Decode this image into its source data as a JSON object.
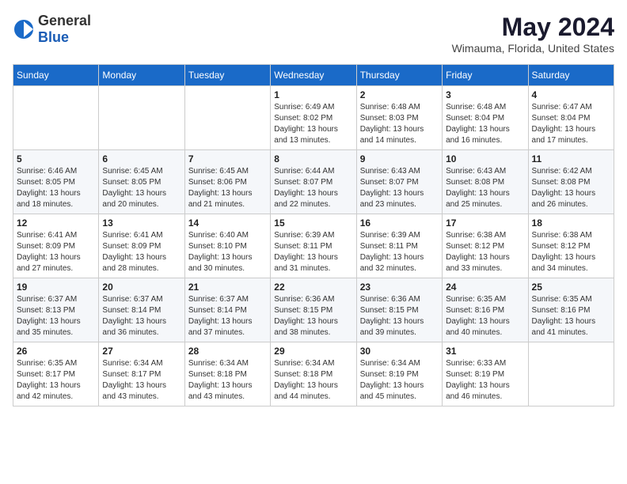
{
  "logo": {
    "general": "General",
    "blue": "Blue"
  },
  "header": {
    "month_year": "May 2024",
    "location": "Wimauma, Florida, United States"
  },
  "weekdays": [
    "Sunday",
    "Monday",
    "Tuesday",
    "Wednesday",
    "Thursday",
    "Friday",
    "Saturday"
  ],
  "weeks": [
    [
      {
        "day": "",
        "info": ""
      },
      {
        "day": "",
        "info": ""
      },
      {
        "day": "",
        "info": ""
      },
      {
        "day": "1",
        "info": "Sunrise: 6:49 AM\nSunset: 8:02 PM\nDaylight: 13 hours\nand 13 minutes."
      },
      {
        "day": "2",
        "info": "Sunrise: 6:48 AM\nSunset: 8:03 PM\nDaylight: 13 hours\nand 14 minutes."
      },
      {
        "day": "3",
        "info": "Sunrise: 6:48 AM\nSunset: 8:04 PM\nDaylight: 13 hours\nand 16 minutes."
      },
      {
        "day": "4",
        "info": "Sunrise: 6:47 AM\nSunset: 8:04 PM\nDaylight: 13 hours\nand 17 minutes."
      }
    ],
    [
      {
        "day": "5",
        "info": "Sunrise: 6:46 AM\nSunset: 8:05 PM\nDaylight: 13 hours\nand 18 minutes."
      },
      {
        "day": "6",
        "info": "Sunrise: 6:45 AM\nSunset: 8:05 PM\nDaylight: 13 hours\nand 20 minutes."
      },
      {
        "day": "7",
        "info": "Sunrise: 6:45 AM\nSunset: 8:06 PM\nDaylight: 13 hours\nand 21 minutes."
      },
      {
        "day": "8",
        "info": "Sunrise: 6:44 AM\nSunset: 8:07 PM\nDaylight: 13 hours\nand 22 minutes."
      },
      {
        "day": "9",
        "info": "Sunrise: 6:43 AM\nSunset: 8:07 PM\nDaylight: 13 hours\nand 23 minutes."
      },
      {
        "day": "10",
        "info": "Sunrise: 6:43 AM\nSunset: 8:08 PM\nDaylight: 13 hours\nand 25 minutes."
      },
      {
        "day": "11",
        "info": "Sunrise: 6:42 AM\nSunset: 8:08 PM\nDaylight: 13 hours\nand 26 minutes."
      }
    ],
    [
      {
        "day": "12",
        "info": "Sunrise: 6:41 AM\nSunset: 8:09 PM\nDaylight: 13 hours\nand 27 minutes."
      },
      {
        "day": "13",
        "info": "Sunrise: 6:41 AM\nSunset: 8:09 PM\nDaylight: 13 hours\nand 28 minutes."
      },
      {
        "day": "14",
        "info": "Sunrise: 6:40 AM\nSunset: 8:10 PM\nDaylight: 13 hours\nand 30 minutes."
      },
      {
        "day": "15",
        "info": "Sunrise: 6:39 AM\nSunset: 8:11 PM\nDaylight: 13 hours\nand 31 minutes."
      },
      {
        "day": "16",
        "info": "Sunrise: 6:39 AM\nSunset: 8:11 PM\nDaylight: 13 hours\nand 32 minutes."
      },
      {
        "day": "17",
        "info": "Sunrise: 6:38 AM\nSunset: 8:12 PM\nDaylight: 13 hours\nand 33 minutes."
      },
      {
        "day": "18",
        "info": "Sunrise: 6:38 AM\nSunset: 8:12 PM\nDaylight: 13 hours\nand 34 minutes."
      }
    ],
    [
      {
        "day": "19",
        "info": "Sunrise: 6:37 AM\nSunset: 8:13 PM\nDaylight: 13 hours\nand 35 minutes."
      },
      {
        "day": "20",
        "info": "Sunrise: 6:37 AM\nSunset: 8:14 PM\nDaylight: 13 hours\nand 36 minutes."
      },
      {
        "day": "21",
        "info": "Sunrise: 6:37 AM\nSunset: 8:14 PM\nDaylight: 13 hours\nand 37 minutes."
      },
      {
        "day": "22",
        "info": "Sunrise: 6:36 AM\nSunset: 8:15 PM\nDaylight: 13 hours\nand 38 minutes."
      },
      {
        "day": "23",
        "info": "Sunrise: 6:36 AM\nSunset: 8:15 PM\nDaylight: 13 hours\nand 39 minutes."
      },
      {
        "day": "24",
        "info": "Sunrise: 6:35 AM\nSunset: 8:16 PM\nDaylight: 13 hours\nand 40 minutes."
      },
      {
        "day": "25",
        "info": "Sunrise: 6:35 AM\nSunset: 8:16 PM\nDaylight: 13 hours\nand 41 minutes."
      }
    ],
    [
      {
        "day": "26",
        "info": "Sunrise: 6:35 AM\nSunset: 8:17 PM\nDaylight: 13 hours\nand 42 minutes."
      },
      {
        "day": "27",
        "info": "Sunrise: 6:34 AM\nSunset: 8:17 PM\nDaylight: 13 hours\nand 43 minutes."
      },
      {
        "day": "28",
        "info": "Sunrise: 6:34 AM\nSunset: 8:18 PM\nDaylight: 13 hours\nand 43 minutes."
      },
      {
        "day": "29",
        "info": "Sunrise: 6:34 AM\nSunset: 8:18 PM\nDaylight: 13 hours\nand 44 minutes."
      },
      {
        "day": "30",
        "info": "Sunrise: 6:34 AM\nSunset: 8:19 PM\nDaylight: 13 hours\nand 45 minutes."
      },
      {
        "day": "31",
        "info": "Sunrise: 6:33 AM\nSunset: 8:19 PM\nDaylight: 13 hours\nand 46 minutes."
      },
      {
        "day": "",
        "info": ""
      }
    ]
  ]
}
